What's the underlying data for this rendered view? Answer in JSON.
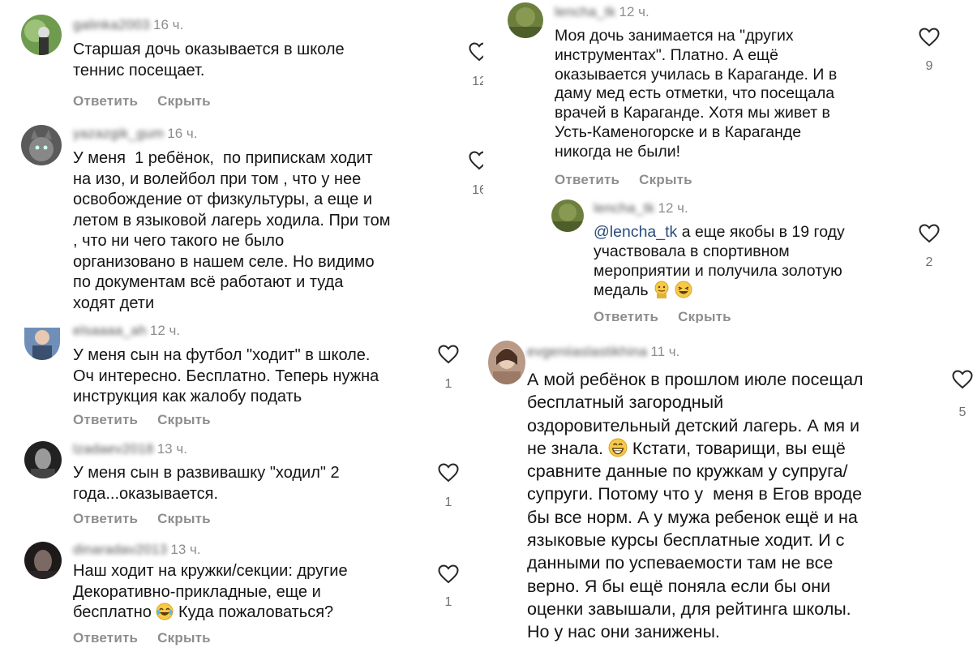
{
  "left": {
    "comments": [
      {
        "username": "galinka2003",
        "time": "16 ч.",
        "text": "Старшая дочь оказывается в школе\nтеннис посещает.",
        "likes": "12",
        "reply": "Ответить",
        "hide": "Скрыть"
      },
      {
        "username": "yazazgik_gum",
        "time": "16 ч.",
        "text": "У меня  1 ребёнок,  по припискам ходит\nна изо, и волейбол при том , что у нее\nосвобождение от физкультуры, а еще и\nлетом в языковой лагерь ходила. При том\n, что ни чего такого не было\nорганизовано в нашем селе. Но видимо\nпо документам всё работают и туда\nходят дети",
        "likes": "16"
      },
      {
        "username": "elsaaaa_ah",
        "time": "12 ч.",
        "text": "У меня сын на футбол \"ходит\" в школе.\nОч интересно. Бесплатно. Теперь нужна\nинструкция как жалобу подать",
        "likes": "1",
        "reply": "Ответить",
        "hide": "Скрыть"
      },
      {
        "username": "lzadaev2018",
        "time": "13 ч.",
        "text": "У меня сын в развивашку \"ходил\" 2\nгода...оказывается.",
        "likes": "1",
        "reply": "Ответить",
        "hide": "Скрыть"
      },
      {
        "username": "dinaradav2013",
        "time": "13 ч.",
        "text_before_emoji": "Наш ходит на кружки/секции: другие\nДекоративно-прикладные, еще и\nбесплатно ",
        "emoji": "face-with-tears-of-joy",
        "text_after_emoji": " Куда пожаловаться?",
        "likes": "1",
        "reply": "Ответить",
        "hide": "Скрыть"
      }
    ]
  },
  "right_top": {
    "comment": {
      "username": "lencha_tk",
      "time": "12 ч.",
      "text": "Моя дочь занимается на \"других\nинструментах\". Платно. А ещё\nоказывается училась в Караганде. И в\nдаму мед есть отметки, что посещала\nврачей в Караганде. Хотя мы живет в\nУсть-Каменогорске и в Караганде\nникогда не были!",
      "likes": "9",
      "reply": "Ответить",
      "hide": "Скрыть"
    },
    "reply": {
      "username": "lencha_tk",
      "time": "12 ч.",
      "mention": "@lencha_tk",
      "text_line1": " а еще якобы в 19 году",
      "text_rest": "участвовала в спортивном\nмероприятии и получила золотую\nмедаль",
      "emojis": [
        "medal-face",
        "laughing-face"
      ],
      "likes": "2",
      "reply": "Ответить",
      "hide": "Скрыть"
    }
  },
  "right_bottom": {
    "comment": {
      "username": "evgeniiaslastikhina",
      "time": "11 ч.",
      "text_before_emoji": "А мой ребёнок в прошлом июле посещал\nбесплатный загородный\nоздоровительный детский лагерь. А мя и\nне знала. ",
      "emoji": "grinning-face",
      "text_after_emoji": " Кстати, товарищи, вы ещё\nсравните данные по кружкам у супруга/\nсупруги. Потому что у  меня в Егов вроде\nбы все норм. А у мужа ребенок ещё и на\nязыковые курсы бесплатные ходит. И с\nданными по успеваемости там не все\nверно. Я бы ещё поняла если бы они\nоценки завышали, для рейтинга школы.\nНо у нас они занижены.",
      "likes": "5"
    }
  },
  "colors": {
    "text": "#141414",
    "meta": "#8e8e8e",
    "mention": "#2a4d7c",
    "emoji": "#f7c948"
  }
}
